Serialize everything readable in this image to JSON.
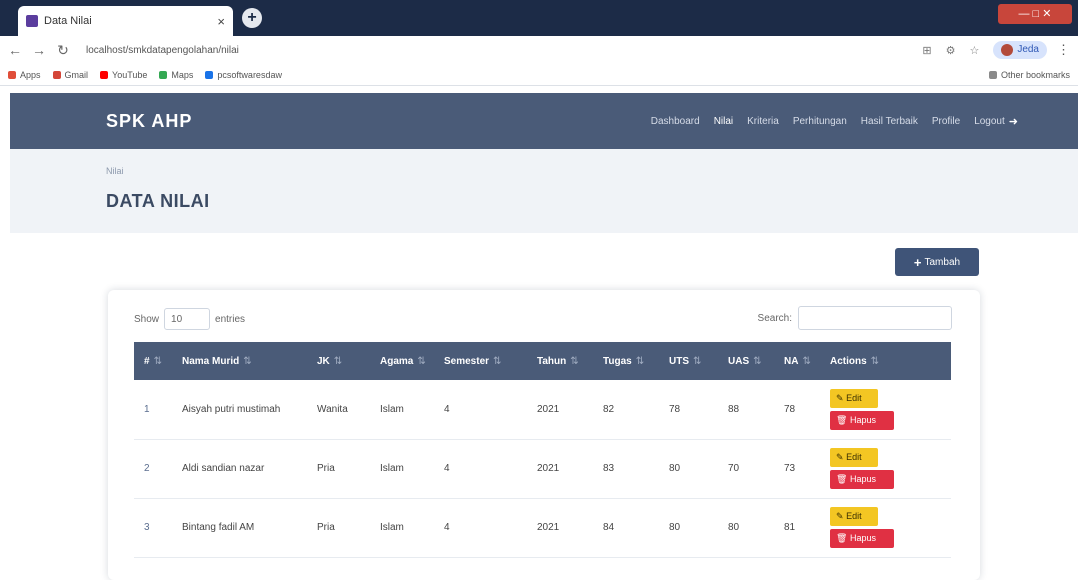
{
  "browser": {
    "tab_title": "Data Nilai",
    "new_tab": "+",
    "close": "×",
    "url": "localhost/smkdatapengolahan/nilai",
    "profile_label": "Jeda",
    "window_controls": "— □ ✕",
    "bookmarks": [
      {
        "label": "Apps",
        "color": "#e04e39"
      },
      {
        "label": "Gmail",
        "color": "#d44638"
      },
      {
        "label": "YouTube",
        "color": "#ff0000"
      },
      {
        "label": "Maps",
        "color": "#34a853"
      },
      {
        "label": "pcsoftwaresdaw",
        "color": "#1a73e8"
      }
    ],
    "other_bookmarks": "Other bookmarks"
  },
  "navbar": {
    "brand": "SPK AHP",
    "links": [
      "Dashboard",
      "Nilai",
      "Kriteria",
      "Perhitungan",
      "Hasil Terbaik",
      "Profile",
      "Logout"
    ]
  },
  "header": {
    "breadcrumb": "Nilai",
    "title": "DATA NILAI"
  },
  "actions": {
    "add_label": "Tambah"
  },
  "table": {
    "show_label": "Show",
    "show_value": "10",
    "entries_label": "entries",
    "search_label": "Search:",
    "headers": [
      "#",
      "Nama Murid",
      "JK",
      "Agama",
      "Semester",
      "Tahun",
      "Tugas",
      "UTS",
      "UAS",
      "NA",
      "Actions"
    ],
    "rows": [
      {
        "no": "1",
        "nama": "Aisyah putri mustimah",
        "jk": "Wanita",
        "agama": "Islam",
        "semester": "4",
        "tahun": "2021",
        "tugas": "82",
        "uts": "78",
        "uas": "88",
        "na": "78"
      },
      {
        "no": "2",
        "nama": "Aldi sandian nazar",
        "jk": "Pria",
        "agama": "Islam",
        "semester": "4",
        "tahun": "2021",
        "tugas": "83",
        "uts": "80",
        "uas": "70",
        "na": "73"
      },
      {
        "no": "3",
        "nama": "Bintang fadil AM",
        "jk": "Pria",
        "agama": "Islam",
        "semester": "4",
        "tahun": "2021",
        "tugas": "84",
        "uts": "80",
        "uas": "80",
        "na": "81"
      }
    ],
    "edit_label": "Edit",
    "delete_label": "Hapus"
  }
}
